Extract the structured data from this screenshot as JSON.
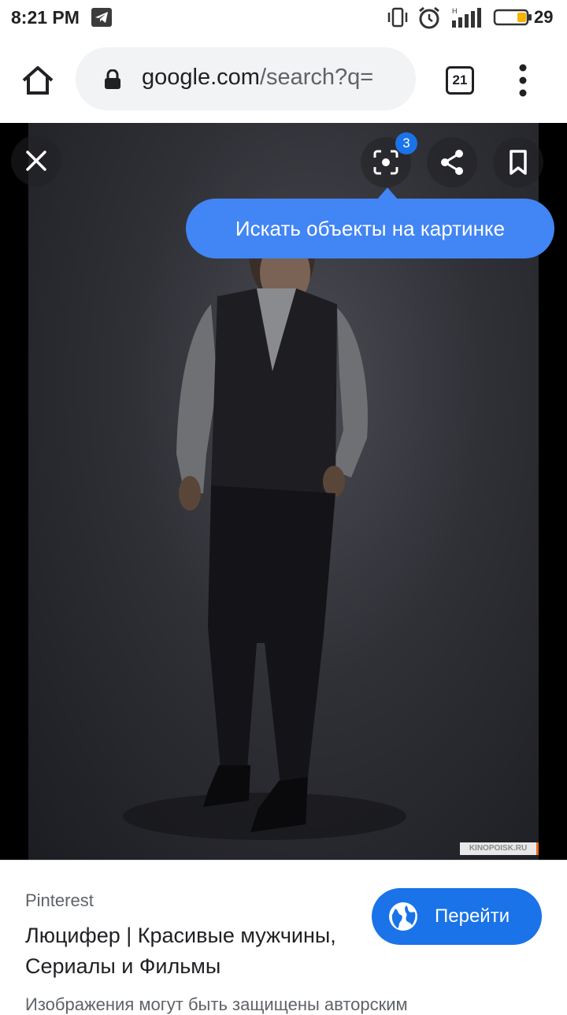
{
  "status_bar": {
    "time": "8:21 PM",
    "battery_level": "29",
    "battery_fraction": 0.29,
    "icons": [
      "telegram-icon",
      "vibrate-icon",
      "alarm-icon",
      "signal-icon",
      "battery-icon"
    ]
  },
  "browser": {
    "url_host": "google.com",
    "url_path": "/search?q=",
    "tab_count": "21",
    "icons": [
      "home-icon",
      "lock-icon",
      "more-vert-icon"
    ]
  },
  "viewer": {
    "lens_badge_count": "3",
    "tooltip": "Искать объекты на картинке",
    "watermark": "KINOPOISK.RU",
    "icons": [
      "close-icon",
      "lens-icon",
      "share-icon",
      "bookmark-icon"
    ]
  },
  "result": {
    "source": "Pinterest",
    "title": "Люцифер | Красивые мужчины, Сериалы и Фильмы",
    "visit_label": "Перейти",
    "copyright_note": "Изображения могут быть защищены авторским"
  },
  "colors": {
    "accent": "#1a73e8",
    "tooltip": "#4285f4",
    "battery_fill": "#f4b400"
  }
}
